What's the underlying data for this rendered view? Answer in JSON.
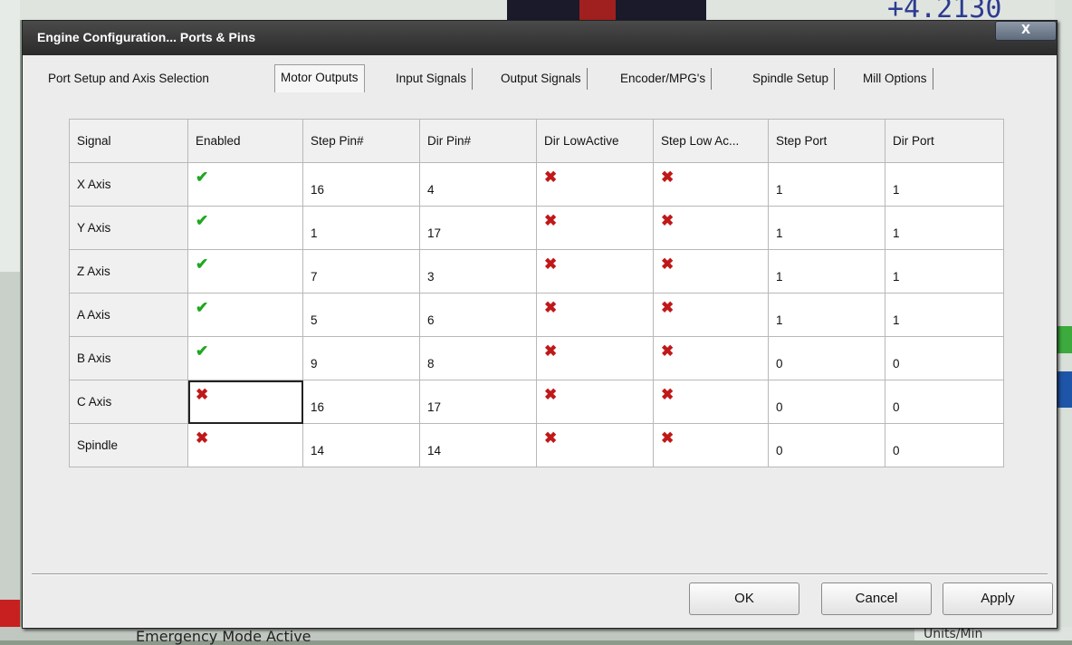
{
  "dialog": {
    "title": "Engine Configuration... Ports & Pins",
    "close_label": "X"
  },
  "tabs": [
    {
      "label": "Port Setup and Axis Selection",
      "active": false
    },
    {
      "label": "Motor Outputs",
      "active": true
    },
    {
      "label": "Input Signals",
      "active": false
    },
    {
      "label": "Output Signals",
      "active": false
    },
    {
      "label": "Encoder/MPG's",
      "active": false
    },
    {
      "label": "Spindle Setup",
      "active": false
    },
    {
      "label": "Mill Options",
      "active": false
    }
  ],
  "table": {
    "columns": [
      "Signal",
      "Enabled",
      "Step Pin#",
      "Dir Pin#",
      "Dir LowActive",
      "Step Low Ac...",
      "Step Port",
      "Dir Port"
    ],
    "rows": [
      {
        "signal": "X Axis",
        "enabled": true,
        "step_pin": "16",
        "dir_pin": "4",
        "dir_low": false,
        "step_low": false,
        "step_port": "1",
        "dir_port": "1"
      },
      {
        "signal": "Y Axis",
        "enabled": true,
        "step_pin": "1",
        "dir_pin": "17",
        "dir_low": false,
        "step_low": false,
        "step_port": "1",
        "dir_port": "1"
      },
      {
        "signal": "Z Axis",
        "enabled": true,
        "step_pin": "7",
        "dir_pin": "3",
        "dir_low": false,
        "step_low": false,
        "step_port": "1",
        "dir_port": "1"
      },
      {
        "signal": "A Axis",
        "enabled": true,
        "step_pin": "5",
        "dir_pin": "6",
        "dir_low": false,
        "step_low": false,
        "step_port": "1",
        "dir_port": "1"
      },
      {
        "signal": "B Axis",
        "enabled": true,
        "step_pin": "9",
        "dir_pin": "8",
        "dir_low": false,
        "step_low": false,
        "step_port": "0",
        "dir_port": "0"
      },
      {
        "signal": "C Axis",
        "enabled": false,
        "step_pin": "16",
        "dir_pin": "17",
        "dir_low": false,
        "step_low": false,
        "step_port": "0",
        "dir_port": "0"
      },
      {
        "signal": "Spindle",
        "enabled": false,
        "step_pin": "14",
        "dir_pin": "14",
        "dir_low": false,
        "step_low": false,
        "step_port": "0",
        "dir_port": "0"
      }
    ]
  },
  "icons": {
    "check": "green-check-icon",
    "cross": "red-x-icon",
    "check_color": "#1fa81f",
    "cross_color": "#c01818"
  },
  "buttons": {
    "ok": "OK",
    "cancel": "Cancel",
    "apply": "Apply"
  },
  "background": {
    "top_readout": "+4.2130",
    "bottom_status": "Emergency Mode Active",
    "bottom_units": "Units/Min"
  }
}
